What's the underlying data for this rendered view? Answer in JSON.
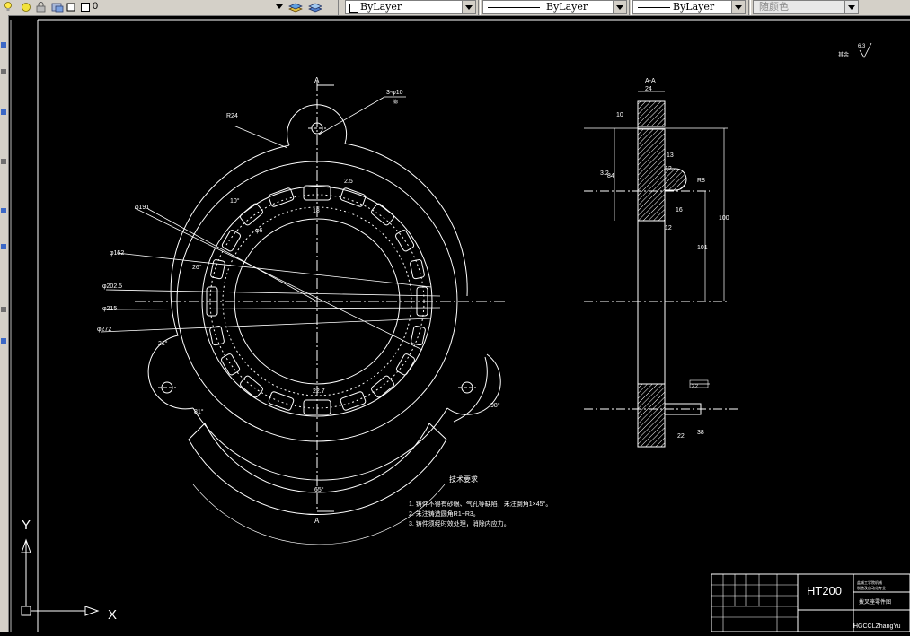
{
  "toolbar": {
    "layer_name": "0",
    "color_combo": "ByLayer",
    "linetype_combo": "ByLayer",
    "lineweight_combo": "ByLayer",
    "plotstyle_combo": "随颜色"
  },
  "drawing": {
    "section_label": "A-A",
    "cut_label_top": "A",
    "cut_label_bottom": "A",
    "hole_note": "3-φ10",
    "hole_note_sub": "锪",
    "roughness_note": "其余",
    "roughness_value": "6.3",
    "dims_front": {
      "r24": "R24",
      "d191": "φ191",
      "d152": "φ152",
      "d202": "φ202.5",
      "d215": "φ215",
      "d272": "φ272",
      "d6": "φ6",
      "w25": "2.5",
      "a10a": "10°",
      "a10b": "10°",
      "a26": "26°",
      "a21": "21°",
      "a81": "81°",
      "a98": "98°",
      "a65": "65°",
      "w18": "18",
      "w22": "22.7"
    },
    "dims_side": {
      "d24": "24",
      "d10": "10",
      "d13": "13",
      "d12a": "12",
      "r8": "R8",
      "d16": "16",
      "d12b": "12",
      "d101": "101",
      "d100": "100",
      "d84": "84",
      "d3": "3.2",
      "d38": "38",
      "d22": "22",
      "rough": "2.2"
    },
    "tech_req_title": "技术要求",
    "tech_req": [
      "1. 铸件不得有砂眼、气孔等缺陷，未注倒角1×45°。",
      "2. 未注铸造圆角R1~R3。",
      "3. 铸件须经时效处理，消除内应力。"
    ]
  },
  "title_block": {
    "material": "HT200",
    "org_line1": "盐城工学院机械",
    "org_line2": "制造及自动化专业",
    "part_name": "拨叉座零件图",
    "watermark": "HGCCLZhangYu"
  },
  "ucs": {
    "x_label": "X",
    "y_label": "Y"
  },
  "colors": {
    "background": "#000000",
    "lines": "#ffffff",
    "toolbar": "#d4d0c8"
  }
}
